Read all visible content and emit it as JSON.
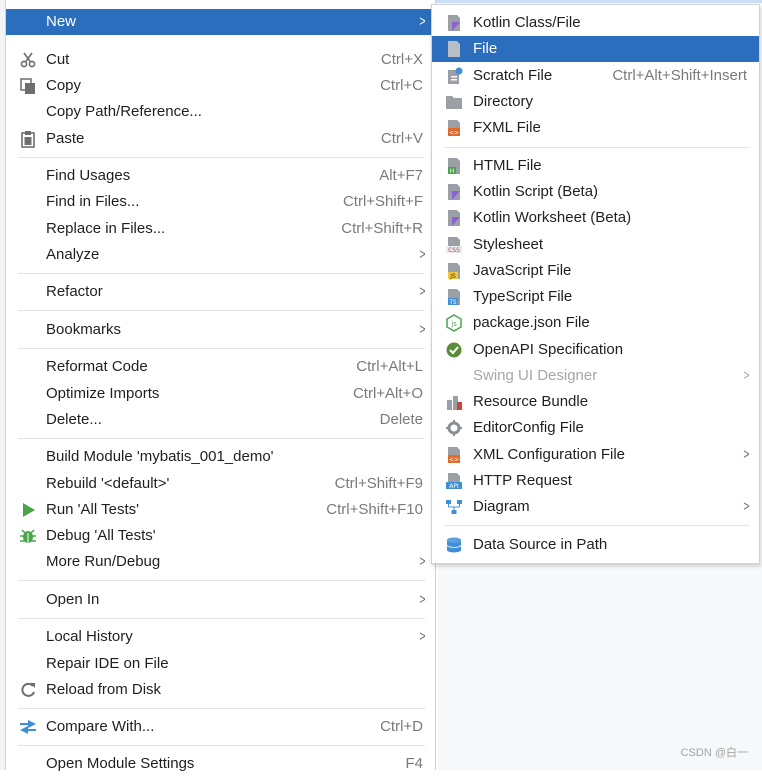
{
  "main_menu": {
    "items": [
      {
        "label": "New"
      },
      {
        "label": "Cut",
        "shortcut": "Ctrl+X"
      },
      {
        "label": "Copy",
        "shortcut": "Ctrl+C"
      },
      {
        "label": "Copy Path/Reference..."
      },
      {
        "label": "Paste",
        "shortcut": "Ctrl+V"
      },
      {
        "label": "Find Usages",
        "shortcut": "Alt+F7"
      },
      {
        "label": "Find in Files...",
        "shortcut": "Ctrl+Shift+F"
      },
      {
        "label": "Replace in Files...",
        "shortcut": "Ctrl+Shift+R"
      },
      {
        "label": "Analyze"
      },
      {
        "label": "Refactor"
      },
      {
        "label": "Bookmarks"
      },
      {
        "label": "Reformat Code",
        "shortcut": "Ctrl+Alt+L"
      },
      {
        "label": "Optimize Imports",
        "shortcut": "Ctrl+Alt+O"
      },
      {
        "label": "Delete...",
        "shortcut": "Delete"
      },
      {
        "label": "Build Module 'mybatis_001_demo'"
      },
      {
        "label": "Rebuild '<default>'",
        "shortcut": "Ctrl+Shift+F9"
      },
      {
        "label": "Run 'All Tests'",
        "shortcut": "Ctrl+Shift+F10"
      },
      {
        "label": "Debug 'All Tests'"
      },
      {
        "label": "More Run/Debug"
      },
      {
        "label": "Open In"
      },
      {
        "label": "Local History"
      },
      {
        "label": "Repair IDE on File"
      },
      {
        "label": "Reload from Disk"
      },
      {
        "label": "Compare With...",
        "shortcut": "Ctrl+D"
      },
      {
        "label": "Open Module Settings",
        "shortcut": "F4"
      }
    ]
  },
  "new_submenu": {
    "items": [
      {
        "label": "Kotlin Class/File"
      },
      {
        "label": "File"
      },
      {
        "label": "Scratch File",
        "shortcut": "Ctrl+Alt+Shift+Insert"
      },
      {
        "label": "Directory"
      },
      {
        "label": "FXML File"
      },
      {
        "label": "HTML File"
      },
      {
        "label": "Kotlin Script (Beta)"
      },
      {
        "label": "Kotlin Worksheet (Beta)"
      },
      {
        "label": "Stylesheet"
      },
      {
        "label": "JavaScript File"
      },
      {
        "label": "TypeScript File"
      },
      {
        "label": "package.json File"
      },
      {
        "label": "OpenAPI Specification"
      },
      {
        "label": "Swing UI Designer"
      },
      {
        "label": "Resource Bundle"
      },
      {
        "label": "EditorConfig File"
      },
      {
        "label": "XML Configuration File"
      },
      {
        "label": "HTTP Request"
      },
      {
        "label": "Diagram"
      },
      {
        "label": "Data Source in Path"
      }
    ]
  },
  "watermark": "CSDN @白一",
  "colors": {
    "highlight": "#2a6ebd",
    "shortcut": "#7a7a7a",
    "disabled": "#a6a6a6"
  }
}
